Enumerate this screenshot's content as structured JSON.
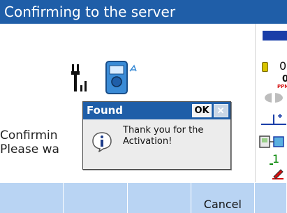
{
  "title": "Confirming to the server",
  "background_message": {
    "line1": "Confirmin",
    "line2": "Please wa"
  },
  "dialog": {
    "title": "Found",
    "ok_label": "OK",
    "message": "Thank you for the Activation!"
  },
  "status": {
    "battery_value": "0",
    "ppm_value": "0",
    "ppm_label": "PPM",
    "level_value": "1"
  },
  "softkeys": [
    {
      "label": ""
    },
    {
      "label": ""
    },
    {
      "label": ""
    },
    {
      "label": "Cancel"
    },
    {
      "label": ""
    }
  ],
  "colors": {
    "title_bar": "#1f5ea8",
    "softkey_bg": "#b9d4f3",
    "status_blue": "#1a3ea8",
    "level_green": "#0b8a0b",
    "ppm_red": "#d41010"
  },
  "icons": [
    "signal-icon",
    "instrument-icon",
    "info-icon",
    "close-icon",
    "battery-icon",
    "target-icon",
    "tilt-icon",
    "device-icon",
    "edit-icon"
  ]
}
